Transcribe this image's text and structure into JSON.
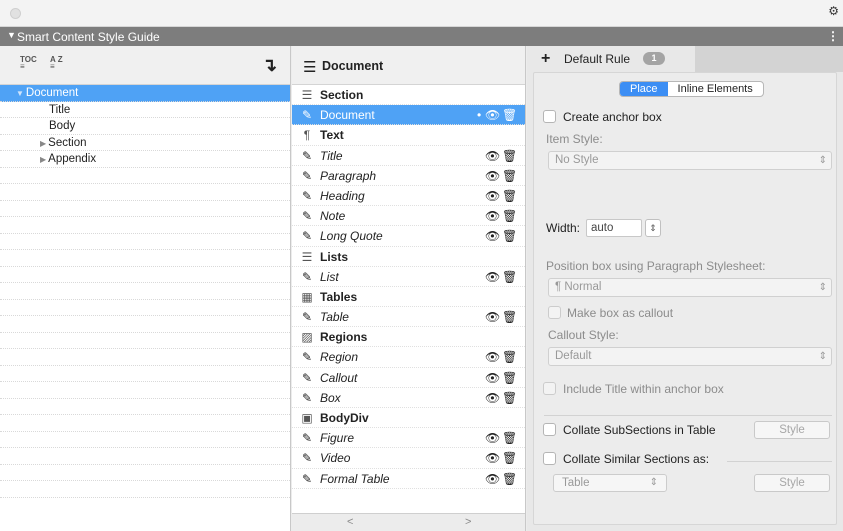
{
  "panel": {
    "title": "Smart Content Style Guide"
  },
  "left": {
    "toolbar": {
      "toc_icon_text": "TOC",
      "az_icon_text": "A Z"
    },
    "tree": [
      {
        "label": "Document",
        "expander": "▼",
        "indent": 0,
        "selected": true
      },
      {
        "label": "Title",
        "expander": "",
        "indent": 1,
        "selected": false
      },
      {
        "label": "Body",
        "expander": "",
        "indent": 1,
        "selected": false
      },
      {
        "label": "Section",
        "expander": "▶",
        "indent": 1,
        "selected": false
      },
      {
        "label": "Appendix",
        "expander": "▶",
        "indent": 1,
        "selected": false
      }
    ],
    "empty_rows": 20
  },
  "middle": {
    "header": "Document",
    "rows": [
      {
        "type": "cat",
        "icon": "☰",
        "icon_name": "section-icon",
        "label": "Section"
      },
      {
        "type": "item",
        "icon": "✎",
        "icon_name": "edit-icon",
        "label": "Document",
        "selected": true,
        "eye": "👁",
        "trash": "🗑"
      },
      {
        "type": "cat",
        "icon": "¶",
        "icon_name": "pilcrow-icon",
        "label": "Text"
      },
      {
        "type": "item",
        "icon": "✎",
        "icon_name": "edit-icon",
        "label": "Title",
        "eye": "👁",
        "trash": "🗑"
      },
      {
        "type": "item",
        "icon": "✎",
        "icon_name": "edit-icon",
        "label": "Paragraph",
        "eye": "👁",
        "trash": "🗑"
      },
      {
        "type": "item",
        "icon": "✎",
        "icon_name": "edit-icon",
        "label": "Heading",
        "eye": "👁",
        "trash": "🗑"
      },
      {
        "type": "item",
        "icon": "✎",
        "icon_name": "edit-icon",
        "label": "Note",
        "eye": "👁",
        "trash": "🗑"
      },
      {
        "type": "item",
        "icon": "✎",
        "icon_name": "edit-icon",
        "label": "Long Quote",
        "eye": "👁",
        "trash": "🗑"
      },
      {
        "type": "cat",
        "icon": "☰",
        "icon_name": "list-icon",
        "label": "Lists"
      },
      {
        "type": "item",
        "icon": "✎",
        "icon_name": "edit-icon",
        "label": "List",
        "eye": "👁",
        "trash": "🗑"
      },
      {
        "type": "cat",
        "icon": "▦",
        "icon_name": "table-icon",
        "label": "Tables"
      },
      {
        "type": "item",
        "icon": "✎",
        "icon_name": "edit-icon",
        "label": "Table",
        "eye": "👁",
        "trash": "🗑"
      },
      {
        "type": "cat",
        "icon": "▨",
        "icon_name": "regions-icon",
        "label": "Regions"
      },
      {
        "type": "item",
        "icon": "✎",
        "icon_name": "edit-icon",
        "label": "Region",
        "eye": "👁",
        "trash": "🗑"
      },
      {
        "type": "item",
        "icon": "✎",
        "icon_name": "edit-icon",
        "label": "Callout",
        "eye": "👁",
        "trash": "🗑"
      },
      {
        "type": "item",
        "icon": "✎",
        "icon_name": "edit-icon",
        "label": "Box",
        "eye": "👁",
        "trash": "🗑"
      },
      {
        "type": "cat",
        "icon": "▣",
        "icon_name": "bodydiv-icon",
        "label": "BodyDiv"
      },
      {
        "type": "item",
        "icon": "✎",
        "icon_name": "edit-icon",
        "label": "Figure",
        "eye": "👁",
        "trash": "🗑"
      },
      {
        "type": "item",
        "icon": "✎",
        "icon_name": "edit-icon",
        "label": "Video",
        "eye": "👁",
        "trash": "🗑"
      },
      {
        "type": "item",
        "icon": "✎",
        "icon_name": "edit-icon",
        "label": "Formal Table",
        "eye": "👁",
        "trash": "🗑"
      }
    ],
    "footer": {
      "prev": "<",
      "next": ">"
    }
  },
  "right": {
    "tab": {
      "plus": "+",
      "label": "Default Rule",
      "badge": "1"
    },
    "segments": {
      "place": "Place",
      "inline": "Inline Elements"
    },
    "create_anchor_box": "Create anchor box",
    "item_style_label": "Item Style:",
    "item_style_value": "No Style",
    "width_label": "Width:",
    "width_value": "auto",
    "position_label": "Position box using Paragraph Stylesheet:",
    "position_value": "¶  Normal",
    "make_callout": "Make box as callout",
    "callout_style_label": "Callout Style:",
    "callout_style_value": "Default",
    "include_title": "Include Title within anchor box",
    "collate_sub": "Collate SubSections in Table",
    "style_btn": "Style",
    "collate_similar": "Collate Similar Sections as:",
    "collate_as_value": "Table",
    "style_btn2": "Style",
    "colors": {
      "selection": "#4fa2f5",
      "segment_on": "#3c8ef4",
      "panel_bar": "#7d7d7d"
    }
  }
}
